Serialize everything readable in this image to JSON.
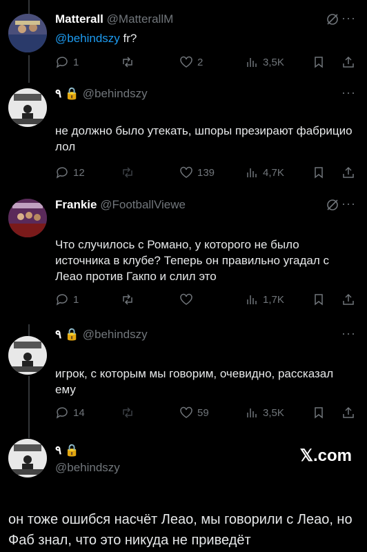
{
  "tweets": [
    {
      "name": "Matterall",
      "handle": "@MatterallM",
      "mention": "@behindszy",
      "text": "fr?",
      "reply": "1",
      "retweet": "",
      "like": "2",
      "views": "3,5K"
    },
    {
      "name_prefix": "۹ 🔒",
      "handle": "@behindszy",
      "text": "не должно было утекать,  шпоры презирают фабрицио лол",
      "reply": "12",
      "retweet": "",
      "like": "139",
      "views": "4,7K"
    },
    {
      "name": "Frankie",
      "handle": "@FootballViewe",
      "text": "Что случилось с Романо, у которого не было источника в клубе? Теперь он правильно угадал с Леао против Гакпо и слил это",
      "reply": "1",
      "retweet": "",
      "like": "",
      "views": "1,7K"
    },
    {
      "name_prefix": "۹ 🔒",
      "handle": "@behindszy",
      "text": "игрок, с которым мы говорим, очевидно, рассказал ему",
      "reply": "14",
      "retweet": "",
      "like": "59",
      "views": "3,5K"
    }
  ],
  "final": {
    "name_prefix": "۹ 🔒",
    "handle": "@behindszy",
    "brand": "𝕏.com",
    "text": "он тоже ошибся насчёт Леао, мы говорили с Леао, но Фаб знал, что это никуда не приведёт"
  },
  "colors": {
    "background": "#000000",
    "text": "#e7e9ea",
    "muted": "#71767b",
    "link": "#1d9bf0"
  }
}
